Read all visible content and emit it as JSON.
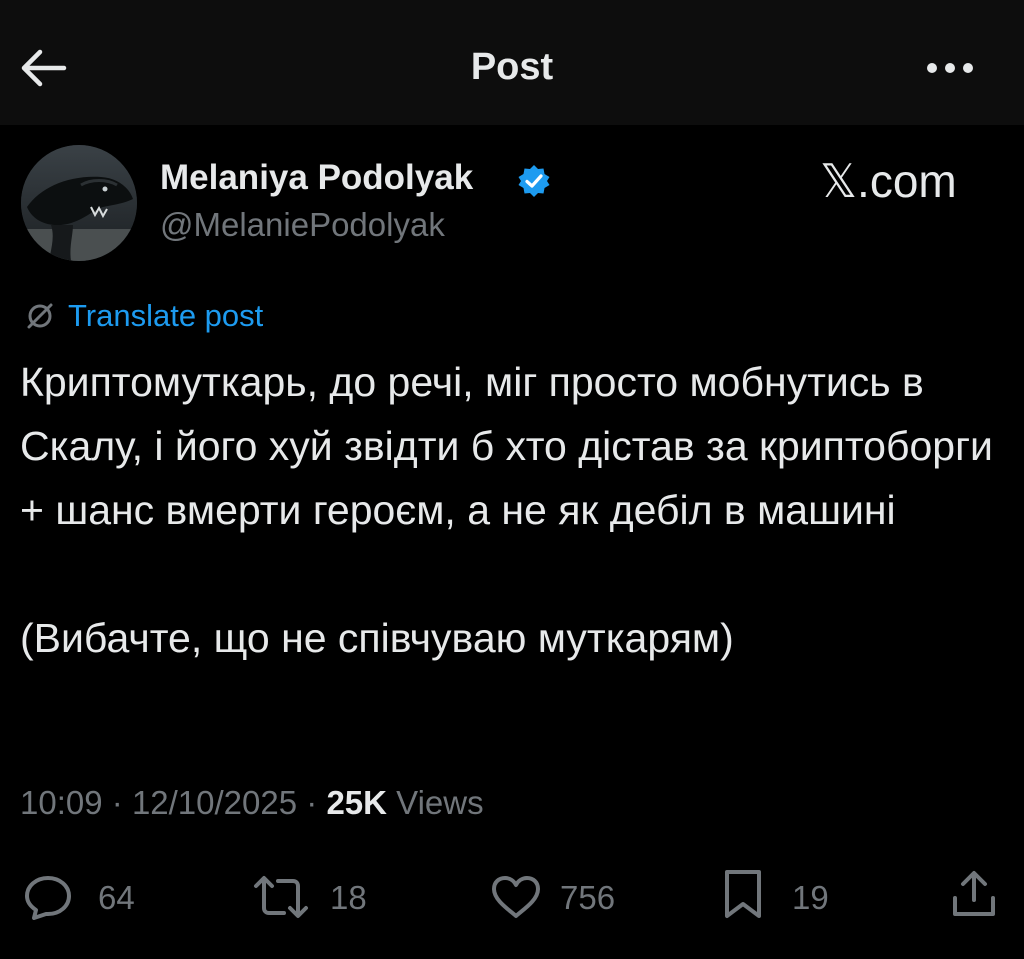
{
  "header": {
    "title": "Post",
    "back_icon": "arrow-left-icon",
    "more_icon": "more-horizontal-icon"
  },
  "author": {
    "name": "Melaniya Podolyak",
    "handle": "@MelaniePodolyak",
    "verified": true,
    "verified_color": "#1d9bf0"
  },
  "watermark": "𝕏.com",
  "translate": {
    "label": "Translate post",
    "icon": "translate-icon",
    "color": "#1d9bf0"
  },
  "tweet": {
    "paragraph1": "Криптомуткарь, до речі, міг просто мобнутись в Скалу, і його хуй звідти б хто дістав за криптоборги + шанс вмерти героєм, а не як дебіл в машині",
    "paragraph2": "(Вибачте, що не співчуваю муткарям)"
  },
  "meta": {
    "time": "10:09",
    "separator": "·",
    "date": "12/10/2025",
    "views_count": "25K",
    "views_label": "Views"
  },
  "actions": {
    "replies": "64",
    "reposts": "18",
    "likes": "756",
    "bookmarks": "19"
  },
  "colors": {
    "background": "#000000",
    "text": "#e7e9ea",
    "muted": "#71767b",
    "accent": "#1d9bf0"
  }
}
